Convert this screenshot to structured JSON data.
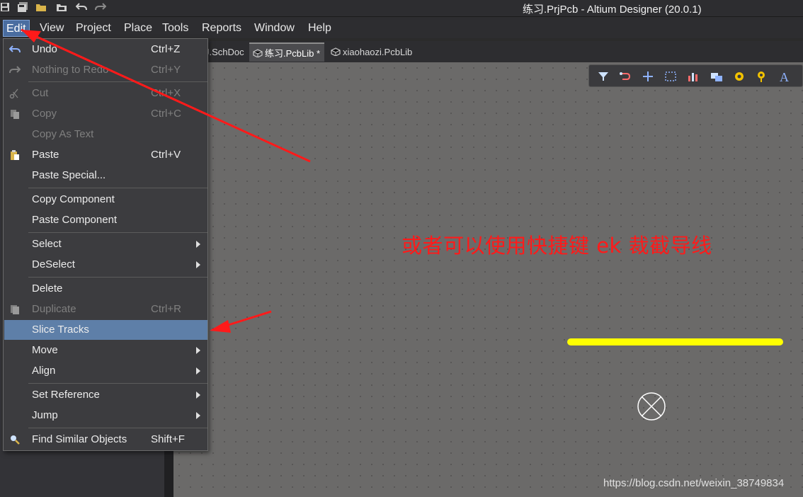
{
  "window": {
    "title": "练习.PrjPcb - Altium Designer (20.0.1)"
  },
  "menubar": {
    "items": [
      {
        "label": "Edit",
        "active": true
      },
      {
        "label": "View"
      },
      {
        "label": "Project"
      },
      {
        "label": "Place"
      },
      {
        "label": "Tools"
      },
      {
        "label": "Reports"
      },
      {
        "label": "Window"
      },
      {
        "label": "Help"
      }
    ]
  },
  "tabs": [
    {
      "label": "J.SchDoc"
    },
    {
      "label": "练习.PcbLib *",
      "active": true
    },
    {
      "label": "xiaohaozi.PcbLib"
    }
  ],
  "edit_menu": {
    "items": [
      {
        "label": "Undo",
        "shortcut": "Ctrl+Z",
        "icon": "undo-icon"
      },
      {
        "label": "Nothing to Redo",
        "shortcut": "Ctrl+Y",
        "icon": "redo-icon",
        "disabled": true
      },
      {
        "label": "Cut",
        "shortcut": "Ctrl+X",
        "icon": "scissors-icon",
        "disabled": true
      },
      {
        "label": "Copy",
        "shortcut": "Ctrl+C",
        "icon": "copy-icon",
        "disabled": true
      },
      {
        "label": "Copy As Text",
        "shortcut": "",
        "disabled": true
      },
      {
        "label": "Paste",
        "shortcut": "Ctrl+V",
        "icon": "paste-icon"
      },
      {
        "label": "Paste Special...",
        "shortcut": ""
      },
      {
        "label": "Copy Component",
        "shortcut": ""
      },
      {
        "label": "Paste Component",
        "shortcut": ""
      },
      {
        "label": "Select",
        "submenu": true
      },
      {
        "label": "DeSelect",
        "submenu": true
      },
      {
        "label": "Delete",
        "shortcut": ""
      },
      {
        "label": "Duplicate",
        "shortcut": "Ctrl+R",
        "icon": "duplicate-icon",
        "disabled": true
      },
      {
        "label": "Slice Tracks",
        "shortcut": "",
        "highlighted": true
      },
      {
        "label": "Move",
        "submenu": true
      },
      {
        "label": "Align",
        "submenu": true
      },
      {
        "label": "Set Reference",
        "submenu": true
      },
      {
        "label": "Jump",
        "submenu": true
      },
      {
        "label": "Find Similar Objects",
        "shortcut": "Shift+F",
        "icon": "find-icon"
      }
    ]
  },
  "canvas": {
    "annotation": "或者可以使用快捷键 ek 裁截导线"
  },
  "toolbar_icons": [
    "filter-icon",
    "route-icon",
    "crosshair-icon",
    "select-rect-icon",
    "chart-icon",
    "component-icon",
    "pad-icon",
    "via-icon",
    "text-icon"
  ],
  "watermark": "https://blog.csdn.net/weixin_38749834",
  "colors": {
    "track": "#ffff00",
    "annotation": "#ff1a1a",
    "menu_highlight": "#5e7fa8"
  }
}
